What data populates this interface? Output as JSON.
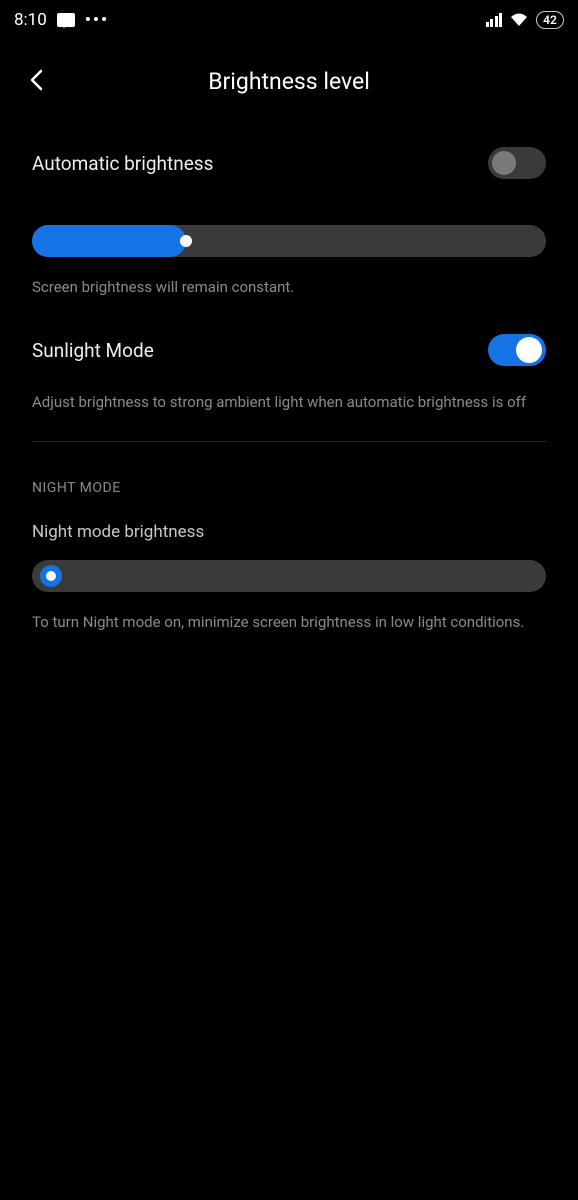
{
  "statusbar": {
    "time": "8:10",
    "battery": "42"
  },
  "header": {
    "title": "Brightness level"
  },
  "auto": {
    "label": "Automatic brightness",
    "enabled": false,
    "slider_percent": 30,
    "helper": "Screen brightness will remain constant."
  },
  "sunlight": {
    "label": "Sunlight Mode",
    "enabled": true,
    "helper": "Adjust brightness to strong ambient light when automatic brightness is off"
  },
  "night": {
    "section": "NIGHT MODE",
    "label": "Night mode brightness",
    "slider_percent": 2,
    "helper": "To turn Night mode on, minimize screen brightness in low light conditions."
  }
}
